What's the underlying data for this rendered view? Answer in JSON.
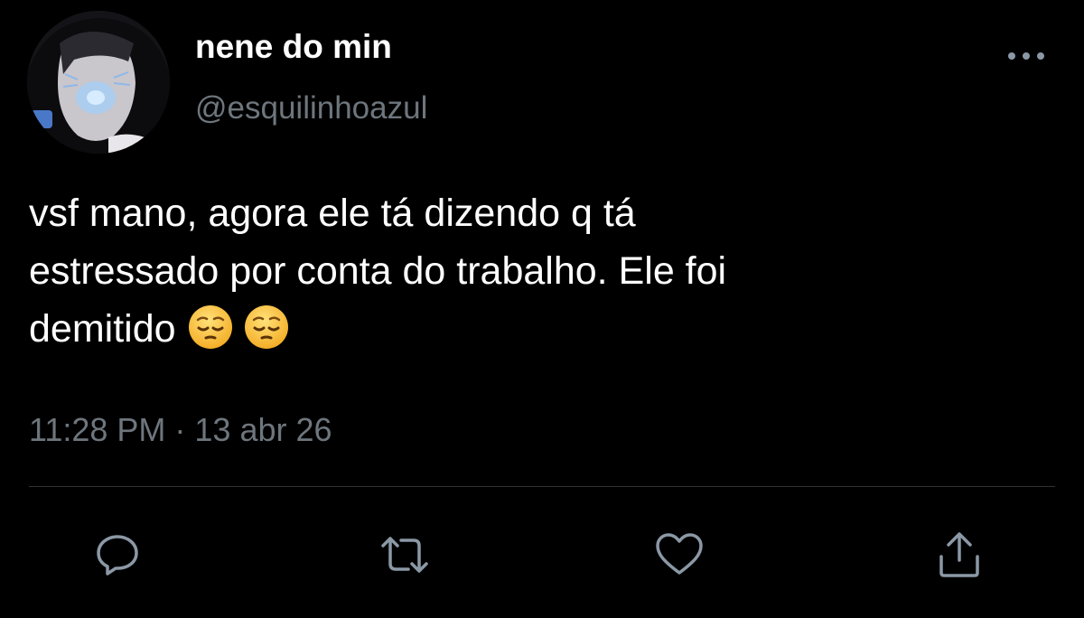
{
  "tweet": {
    "author_name": "nene do min",
    "author_handle": "@esquilinhoazul",
    "text_lines": [
      "vsf mano, agora ele tá dizendo q tá",
      "estressado por conta do trabalho. Ele foi",
      "demitido"
    ],
    "emojis": [
      "pensive-face",
      "pensive-face"
    ],
    "timestamp": "11:28 PM · 13 abr 26"
  },
  "actions": [
    {
      "name": "reply",
      "icon": "speech-bubble-icon"
    },
    {
      "name": "retweet",
      "icon": "retweet-arrows-icon"
    },
    {
      "name": "like",
      "icon": "heart-icon"
    },
    {
      "name": "share",
      "icon": "share-upload-icon"
    }
  ],
  "colors": {
    "background": "#000000",
    "primary_text": "#ffffff",
    "secondary_text": "#6e767d",
    "icon": "#8b98a5",
    "divider": "#2f3336"
  }
}
